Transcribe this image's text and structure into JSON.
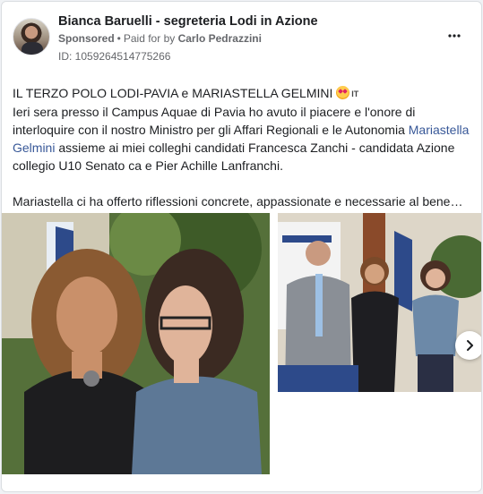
{
  "post": {
    "page_name": "Bianca Baruelli - segreteria Lodi in Azione",
    "sponsored_label": "Sponsored",
    "paid_for_prefix": "Paid for by",
    "paid_for_name": "Carlo Pedrazzini",
    "ad_id": "ID: 1059264514775266",
    "more_icon": "more-horizontal-icon"
  },
  "body": {
    "line1_text": "IL TERZO POLO LODI-PAVIA e MARIASTELLA GELMINI ",
    "line1_flag": "IT",
    "paragraph1_part1": "Ieri sera presso il Campus Aquae di Pavia ho avuto il piacere e l'onore di interloquire con il nostro Ministro per gli Affari Regionali e le Autonomia ",
    "mention": "Mariastella Gelmini",
    "paragraph1_part2": " assieme ai miei colleghi candidati Francesca Zanchi - candidata Azione collegio U10 Senato ca e Pier Achille Lanfranchi.",
    "paragraph2": "Mariastella ci ha offerto riflessioni concrete, appassionate e necessarie al bene…"
  },
  "carousel": {
    "next_icon": "chevron-right-icon"
  },
  "colors": {
    "link": "#385898",
    "meta": "#65676b",
    "text": "#1c1e21"
  }
}
